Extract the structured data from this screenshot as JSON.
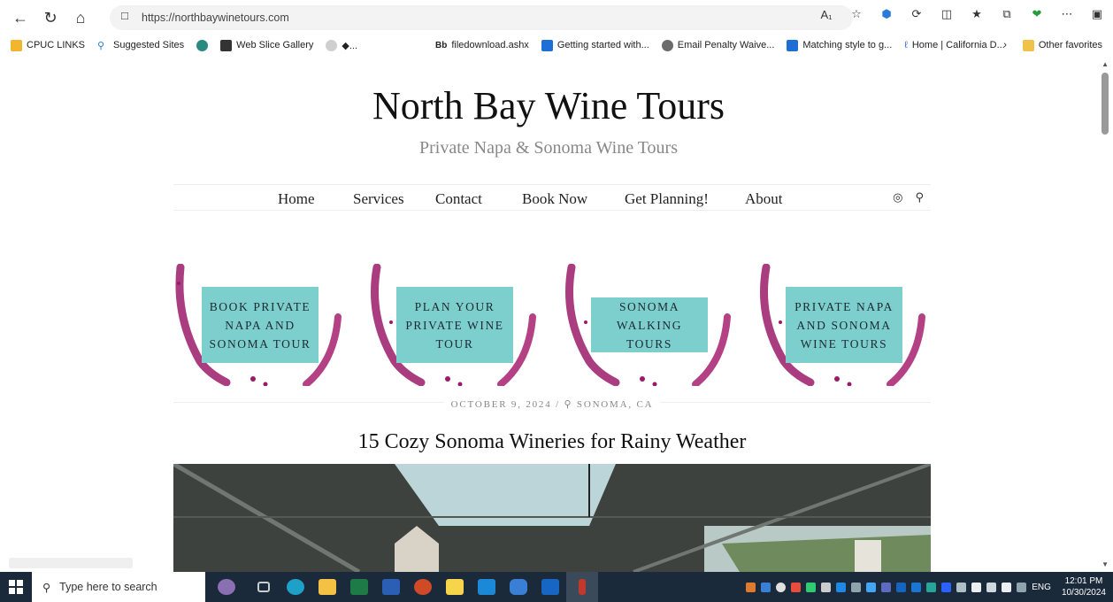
{
  "browser": {
    "url": "https://northbaywinetours.com",
    "favorites": [
      {
        "label": "CPUC LINKS",
        "color": "#f1b52e"
      },
      {
        "label": "Suggested Sites",
        "color": "#2a7ad9"
      },
      {
        "label": "",
        "color": "#2b8a7f"
      },
      {
        "label": "Web Slice Gallery",
        "color": "#333333"
      },
      {
        "label": "◆...",
        "color": "#cfcfcf"
      },
      {
        "label": "filedownload.ashx",
        "color": "#111111",
        "prefix": "Bb"
      },
      {
        "label": "Getting started with...",
        "color": "#1d6fd6"
      },
      {
        "label": "Email Penalty Waive...",
        "color": "#6b6b6b"
      },
      {
        "label": "Matching style to g...",
        "color": "#1d6fd6"
      },
      {
        "label": "Home | California D...",
        "color": "#3a6ed0"
      }
    ],
    "other_favorites": "Other favorites"
  },
  "site": {
    "title": "North Bay Wine Tours",
    "tagline": "Private Napa & Sonoma Wine Tours",
    "menu": [
      "Home",
      "Services",
      "Contact",
      "Book Now",
      "Get Planning!",
      "About"
    ],
    "promos": [
      {
        "line1": "BOOK PRIVATE",
        "line2": "NAPA AND",
        "line3": "SONOMA TOUR"
      },
      {
        "line1": "PLAN YOUR",
        "line2": "PRIVATE WINE",
        "line3": "TOUR"
      },
      {
        "line1": "SONOMA",
        "line2": "WALKING TOURS",
        "line3": ""
      },
      {
        "line1": "PRIVATE NAPA",
        "line2": "AND SONOMA",
        "line3": "WINE TOURS"
      }
    ],
    "post": {
      "date": "OCTOBER 9, 2024",
      "location": "SONOMA, CA",
      "title": "15 Cozy Sonoma Wineries for Rainy Weather"
    }
  },
  "taskbar": {
    "search_placeholder": "Type here to search",
    "lang": "ENG",
    "time": "12:01 PM",
    "date": "10/30/2024"
  }
}
